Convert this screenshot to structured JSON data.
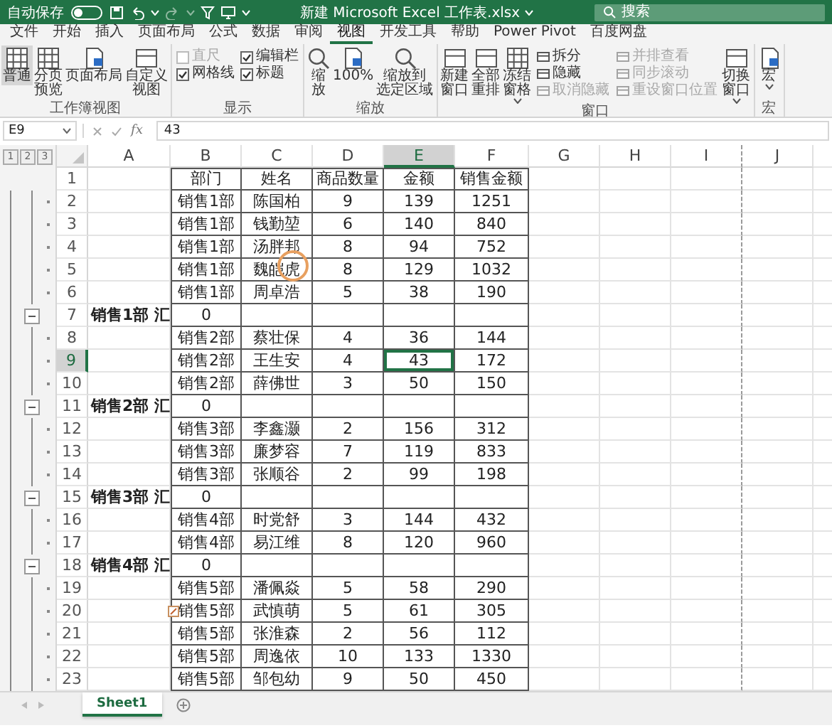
{
  "title_bar": {
    "autosave_label": "自动保存",
    "autosave_on": false,
    "title": "新建 Microsoft Excel 工作表.xlsx",
    "search_placeholder": "搜索"
  },
  "ribbon_tabs": [
    {
      "label": "文件",
      "selected": false
    },
    {
      "label": "开始",
      "selected": false
    },
    {
      "label": "插入",
      "selected": false
    },
    {
      "label": "页面布局",
      "selected": false
    },
    {
      "label": "公式",
      "selected": false
    },
    {
      "label": "数据",
      "selected": false
    },
    {
      "label": "审阅",
      "selected": false
    },
    {
      "label": "视图",
      "selected": true
    },
    {
      "label": "开发工具",
      "selected": false
    },
    {
      "label": "帮助",
      "selected": false
    },
    {
      "label": "Power Pivot",
      "selected": false
    },
    {
      "label": "百度网盘",
      "selected": false
    }
  ],
  "ribbon_groups": [
    {
      "label": "工作簿视图",
      "items": [
        {
          "kind": "large",
          "lines": [
            "普通"
          ],
          "selected": true
        },
        {
          "kind": "large",
          "lines": [
            "分页",
            "预览"
          ],
          "selected": false
        },
        {
          "kind": "large",
          "lines": [
            "页面布局"
          ],
          "selected": false
        },
        {
          "kind": "large",
          "lines": [
            "自定义",
            "视图"
          ],
          "selected": false
        }
      ]
    },
    {
      "label": "显示",
      "items": [
        {
          "kind": "stack",
          "items": [
            {
              "kind": "check",
              "label": "直尺",
              "checked": false,
              "disabled": true
            },
            {
              "kind": "check",
              "label": "网格线",
              "checked": true,
              "disabled": false
            }
          ]
        },
        {
          "kind": "stack",
          "items": [
            {
              "kind": "check",
              "label": "编辑栏",
              "checked": true,
              "disabled": false
            },
            {
              "kind": "check",
              "label": "标题",
              "checked": true,
              "disabled": false
            }
          ]
        }
      ]
    },
    {
      "label": "缩放",
      "items": [
        {
          "kind": "large",
          "lines": [
            "缩",
            "放"
          ]
        },
        {
          "kind": "large",
          "lines": [
            "100%"
          ]
        },
        {
          "kind": "large",
          "lines": [
            "缩放到",
            "选定区域"
          ]
        }
      ]
    },
    {
      "label": "窗口",
      "items": [
        {
          "kind": "large",
          "lines": [
            "新建",
            "窗口"
          ]
        },
        {
          "kind": "large",
          "lines": [
            "全部",
            "重排"
          ]
        },
        {
          "kind": "large",
          "lines": [
            "冻结",
            "窗格"
          ],
          "has_menu": true
        },
        {
          "kind": "stack",
          "items": [
            {
              "kind": "small",
              "label": "拆分",
              "disabled": false
            },
            {
              "kind": "small",
              "label": "隐藏",
              "disabled": false
            },
            {
              "kind": "small",
              "label": "取消隐藏",
              "disabled": true
            }
          ]
        },
        {
          "kind": "stack",
          "items": [
            {
              "kind": "small",
              "label": "并排查看",
              "disabled": true
            },
            {
              "kind": "small",
              "label": "同步滚动",
              "disabled": true
            },
            {
              "kind": "small",
              "label": "重设窗口位置",
              "disabled": true
            }
          ]
        },
        {
          "kind": "large",
          "lines": [
            "切换",
            "窗口"
          ],
          "has_menu": true
        }
      ]
    },
    {
      "label": "宏",
      "items": [
        {
          "kind": "large",
          "lines": [
            "宏"
          ],
          "has_menu": true
        }
      ]
    }
  ],
  "formula_bar": {
    "name_box": "E9",
    "function_label": "fx",
    "value": "43"
  },
  "sheet": {
    "outline_levels": [
      "1",
      "2",
      "3"
    ],
    "columns": [
      {
        "label": "A",
        "selected": false
      },
      {
        "label": "B",
        "selected": false
      },
      {
        "label": "C",
        "selected": false
      },
      {
        "label": "D",
        "selected": false
      },
      {
        "label": "E",
        "selected": true
      },
      {
        "label": "F",
        "selected": false
      },
      {
        "label": "G",
        "selected": false
      },
      {
        "label": "H",
        "selected": false
      },
      {
        "label": "I",
        "selected": false
      },
      {
        "label": "J",
        "selected": false
      }
    ],
    "rows": [
      {
        "number": "1",
        "kind": "header",
        "selected": false,
        "cells": {
          "b": "部门",
          "c": "姓名",
          "d": "商品数量",
          "e": "金额",
          "f": "销售金额"
        }
      },
      {
        "number": "2",
        "kind": "detail",
        "selected": false,
        "cells": {
          "b": "销售1部",
          "c": "陈国柏",
          "d": "9",
          "e": "139",
          "f": "1251"
        }
      },
      {
        "number": "3",
        "kind": "detail",
        "selected": false,
        "cells": {
          "b": "销售1部",
          "c": "钱勤堃",
          "d": "6",
          "e": "140",
          "f": "840"
        }
      },
      {
        "number": "4",
        "kind": "detail",
        "selected": false,
        "cells": {
          "b": "销售1部",
          "c": "汤胖邦",
          "d": "8",
          "e": "94",
          "f": "752"
        }
      },
      {
        "number": "5",
        "kind": "detail",
        "selected": false,
        "cells": {
          "b": "销售1部",
          "c": "魏皑虎",
          "d": "8",
          "e": "129",
          "f": "1032"
        }
      },
      {
        "number": "6",
        "kind": "detail",
        "selected": false,
        "cells": {
          "b": "销售1部",
          "c": "周卓浩",
          "d": "5",
          "e": "38",
          "f": "190"
        }
      },
      {
        "number": "7",
        "kind": "summary",
        "selected": false,
        "cells": {
          "a": "销售1部 汇",
          "b": "0"
        }
      },
      {
        "number": "8",
        "kind": "detail",
        "selected": false,
        "cells": {
          "b": "销售2部",
          "c": "蔡壮保",
          "d": "4",
          "e": "36",
          "f": "144"
        }
      },
      {
        "number": "9",
        "kind": "detail",
        "selected": true,
        "cells": {
          "b": "销售2部",
          "c": "王生安",
          "d": "4",
          "e": "43",
          "f": "172"
        }
      },
      {
        "number": "10",
        "kind": "detail",
        "selected": false,
        "cells": {
          "b": "销售2部",
          "c": "薛佛世",
          "d": "3",
          "e": "50",
          "f": "150"
        }
      },
      {
        "number": "11",
        "kind": "summary",
        "selected": false,
        "cells": {
          "a": "销售2部 汇",
          "b": "0"
        }
      },
      {
        "number": "12",
        "kind": "detail",
        "selected": false,
        "cells": {
          "b": "销售3部",
          "c": "李鑫灏",
          "d": "2",
          "e": "156",
          "f": "312"
        }
      },
      {
        "number": "13",
        "kind": "detail",
        "selected": false,
        "cells": {
          "b": "销售3部",
          "c": "廉梦容",
          "d": "7",
          "e": "119",
          "f": "833"
        }
      },
      {
        "number": "14",
        "kind": "detail",
        "selected": false,
        "cells": {
          "b": "销售3部",
          "c": "张顺谷",
          "d": "2",
          "e": "99",
          "f": "198"
        }
      },
      {
        "number": "15",
        "kind": "summary",
        "selected": false,
        "cells": {
          "a": "销售3部 汇",
          "b": "0"
        }
      },
      {
        "number": "16",
        "kind": "detail",
        "selected": false,
        "cells": {
          "b": "销售4部",
          "c": "时党舒",
          "d": "3",
          "e": "144",
          "f": "432"
        }
      },
      {
        "number": "17",
        "kind": "detail",
        "selected": false,
        "cells": {
          "b": "销售4部",
          "c": "易江维",
          "d": "8",
          "e": "120",
          "f": "960"
        }
      },
      {
        "number": "18",
        "kind": "summary",
        "selected": false,
        "cells": {
          "a": "销售4部 汇",
          "b": "0"
        }
      },
      {
        "number": "19",
        "kind": "detail",
        "selected": false,
        "cells": {
          "b": "销售5部",
          "c": "潘佩焱",
          "d": "5",
          "e": "58",
          "f": "290"
        }
      },
      {
        "number": "20",
        "kind": "detail",
        "selected": false,
        "cells": {
          "b": "销售5部",
          "c": "武慎萌",
          "d": "5",
          "e": "61",
          "f": "305"
        }
      },
      {
        "number": "21",
        "kind": "detail",
        "selected": false,
        "cells": {
          "b": "销售5部",
          "c": "张淮森",
          "d": "2",
          "e": "56",
          "f": "112"
        }
      },
      {
        "number": "22",
        "kind": "detail",
        "selected": false,
        "cells": {
          "b": "销售5部",
          "c": "周逸依",
          "d": "10",
          "e": "133",
          "f": "1330"
        }
      },
      {
        "number": "23",
        "kind": "detail",
        "selected": false,
        "cells": {
          "b": "销售5部",
          "c": "邹包幼",
          "d": "9",
          "e": "50",
          "f": "450"
        }
      }
    ]
  },
  "sheet_tabs": [
    {
      "label": "Sheet1",
      "selected": true
    }
  ]
}
